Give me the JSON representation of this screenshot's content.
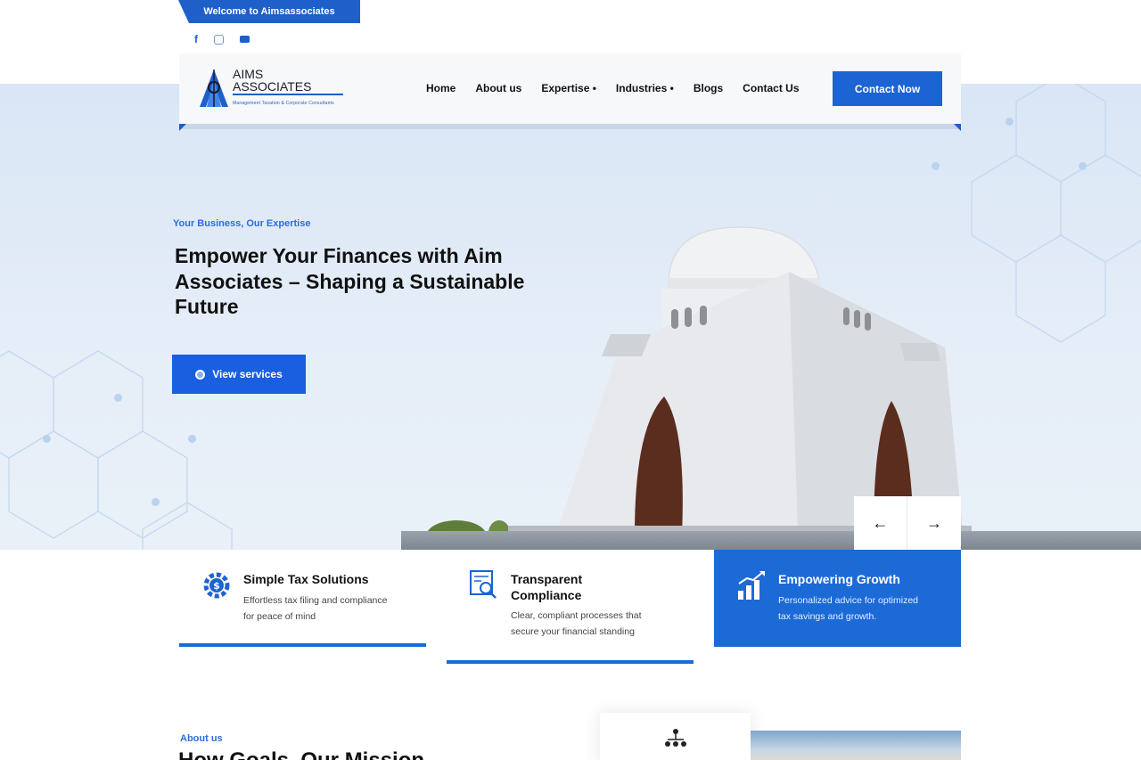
{
  "topbar": {
    "welcome_text": "Welcome to Aimsassociates",
    "social_icons": [
      "facebook-icon",
      "instagram-icon",
      "youtube-icon"
    ]
  },
  "header": {
    "logo": {
      "line1": "AIMS",
      "line2": "ASSOCIATES",
      "tagline": "Management Taxation & Corporate Consultants"
    },
    "nav": [
      {
        "label": "Home"
      },
      {
        "label": "About us"
      },
      {
        "label": "Expertise",
        "dropdown": true
      },
      {
        "label": "Industries",
        "dropdown": true
      },
      {
        "label": "Blogs"
      },
      {
        "label": "Contact Us"
      }
    ],
    "cta_label": "Contact Now"
  },
  "hero": {
    "eyebrow": "Your Business, Our Expertise",
    "title": "Empower Your Finances with Aim Associates – Shaping a Sustainable Future",
    "button_label": "View services",
    "prev_arrow": "←",
    "next_arrow": "→"
  },
  "features": [
    {
      "title": "Simple Tax Solutions",
      "desc_line1": "Effortless tax filing and compliance",
      "desc_line2": "for peace of mind",
      "icon": "gear-dollar-icon"
    },
    {
      "title_line1": "Transparent",
      "title_line2": "Compliance",
      "desc_line1": "Clear, compliant processes that",
      "desc_line2": "secure your financial standing",
      "icon": "document-search-icon"
    },
    {
      "title": "Empowering Growth",
      "desc_line1": "Personalized advice for optimized",
      "desc_line2": "tax savings and growth.",
      "icon": "growth-chart-icon"
    }
  ],
  "about": {
    "eyebrow": "About us",
    "title": "How Goals, Our Mission"
  },
  "colors": {
    "accent": "#1c63d4",
    "hero_bg": "#dfe9f6"
  }
}
